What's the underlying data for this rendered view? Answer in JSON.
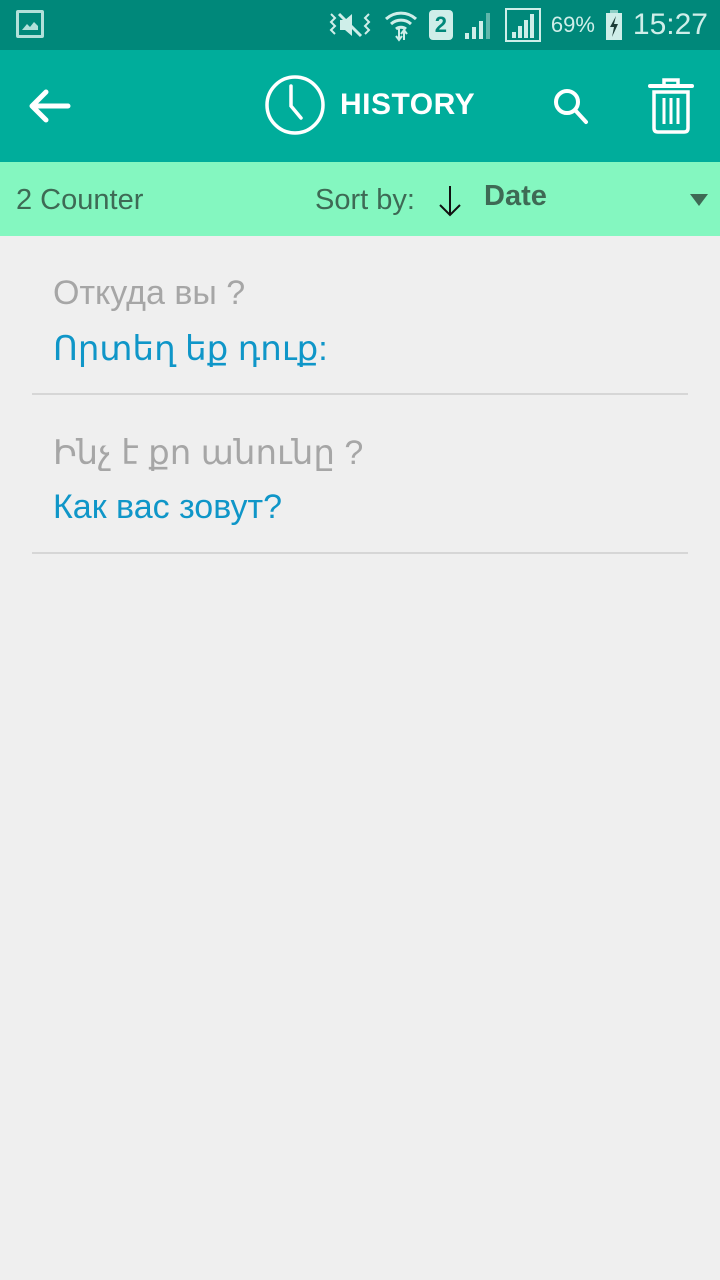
{
  "status_bar": {
    "battery_percent": "69%",
    "time": "15:27",
    "sim_label": "2",
    "icons": [
      "gallery-notification-icon",
      "mute-vibrate-icon",
      "wifi-icon",
      "sim-2-icon",
      "signal-icon",
      "signal-icon",
      "battery-charging-icon"
    ]
  },
  "appbar": {
    "title": "HISTORY",
    "icons": [
      "back-arrow-icon",
      "clock-icon",
      "search-icon",
      "trash-icon"
    ]
  },
  "sortbar": {
    "counter_label": "2 Counter",
    "sort_label": "Sort by:",
    "sort_direction_icon": "arrow-down-icon",
    "sort_value": "Date"
  },
  "history": [
    {
      "source": "Откуда вы ?",
      "translation": "Որտեղ եք դուք:"
    },
    {
      "source": "Ինչ է քո անունը ?",
      "translation": "Как вас зовут?"
    }
  ],
  "colors": {
    "status_bar": "#00887a",
    "app_bar": "#00ad9b",
    "sort_bar": "#84f7c0",
    "source_text": "#a6a6a6",
    "translation_text": "#0f96c8",
    "background": "#efefef"
  }
}
